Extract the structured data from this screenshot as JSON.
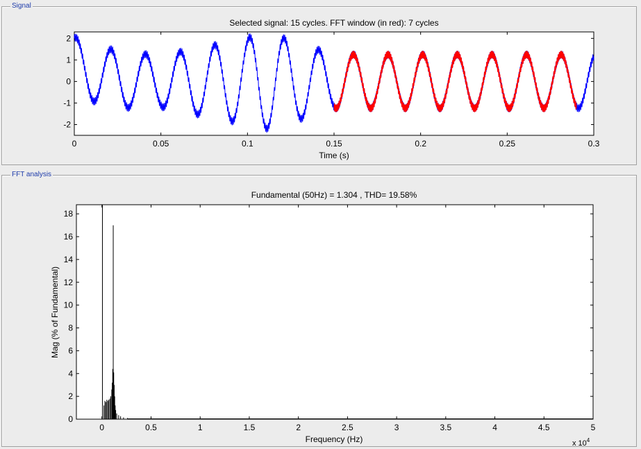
{
  "panels": {
    "signal_title": "Signal",
    "fft_title": "FFT analysis"
  },
  "colors": {
    "selected_signal": "#0000ff",
    "fft_window": "#ff0000",
    "panel_title": "#1c3aa9",
    "background": "#ececec"
  },
  "chart_data": [
    {
      "type": "line",
      "title": "Selected signal: 15 cycles. FFT window (in red): 7 cycles",
      "xlabel": "Time (s)",
      "ylabel": "",
      "xlim": [
        0,
        0.3
      ],
      "ylim": [
        -2.5,
        2.3
      ],
      "x_ticks": [
        "0",
        "0.05",
        "0.1",
        "0.15",
        "0.2",
        "0.25",
        "0.3"
      ],
      "y_ticks": [
        "2",
        "1",
        "0",
        "-1",
        "-2"
      ],
      "grid": false,
      "series": [
        {
          "color": "#0000ff",
          "x_range": [
            0,
            0.3
          ]
        },
        {
          "color": "#ff0000",
          "x_range": [
            0.15,
            0.29
          ]
        }
      ],
      "fundamental_hz": 50,
      "envelope": {
        "t": [
          0,
          0.02,
          0.05,
          0.1,
          0.105,
          0.115,
          0.125,
          0.15,
          0.3
        ],
        "amp": [
          1.2,
          1.35,
          1.2,
          2.0,
          2.2,
          2.2,
          1.9,
          1.25,
          1.25
        ]
      },
      "ripple_amp": 0.18
    },
    {
      "type": "bar",
      "title": "Fundamental (50Hz) = 1.304 , THD= 19.58%",
      "xlabel": "Frequency (Hz)",
      "ylabel": "Mag (% of Fundamental)",
      "x_multiplier": "x 10",
      "x_multiplier_exp": "4",
      "xlim": [
        -2600,
        50000
      ],
      "ylim": [
        0,
        18.8
      ],
      "x_ticks": [
        "0",
        "0.5",
        "1",
        "1.5",
        "2",
        "2.5",
        "3",
        "3.5",
        "4",
        "4.5",
        "5"
      ],
      "y_ticks": [
        "18",
        "16",
        "14",
        "12",
        "10",
        "8",
        "6",
        "4",
        "2",
        "0"
      ],
      "grid": false,
      "series": [
        {
          "color": "#000000",
          "x": [
            50,
            200,
            300,
            400,
            500,
            600,
            700,
            800,
            900,
            1000,
            1050,
            1100,
            1150,
            1200,
            1250,
            1300,
            1350,
            1400,
            1500,
            1700,
            1900,
            2200,
            2600
          ],
          "values": [
            100,
            1.2,
            1.6,
            1.5,
            1.7,
            1.6,
            1.7,
            1.8,
            2.0,
            2.6,
            3.2,
            4.4,
            17.0,
            4.1,
            3.0,
            2.0,
            1.2,
            0.8,
            0.5,
            0.35,
            0.25,
            0.15,
            0.1
          ]
        }
      ]
    }
  ]
}
